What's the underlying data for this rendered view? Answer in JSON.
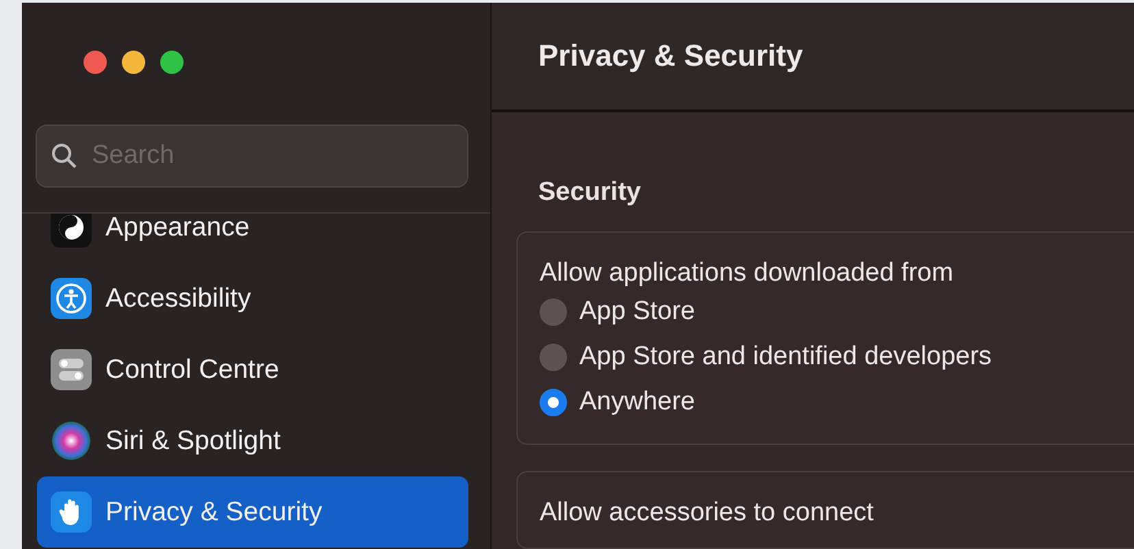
{
  "window": {
    "title": "Privacy & Security"
  },
  "search": {
    "placeholder": "Search"
  },
  "sidebar": {
    "items": [
      {
        "label": "Appearance",
        "kind": "appearance",
        "selected": false
      },
      {
        "label": "Accessibility",
        "kind": "accessibility",
        "selected": false
      },
      {
        "label": "Control Centre",
        "kind": "control",
        "selected": false
      },
      {
        "label": "Siri & Spotlight",
        "kind": "siri",
        "selected": false
      },
      {
        "label": "Privacy & Security",
        "kind": "privacy",
        "selected": true
      }
    ]
  },
  "section": {
    "title": "Security",
    "download_card": {
      "label": "Allow applications downloaded from",
      "options": [
        {
          "label": "App Store",
          "selected": false
        },
        {
          "label": "App Store and identified developers",
          "selected": false
        },
        {
          "label": "Anywhere",
          "selected": true
        }
      ]
    },
    "accessories_card": {
      "label": "Allow accessories to connect"
    }
  }
}
